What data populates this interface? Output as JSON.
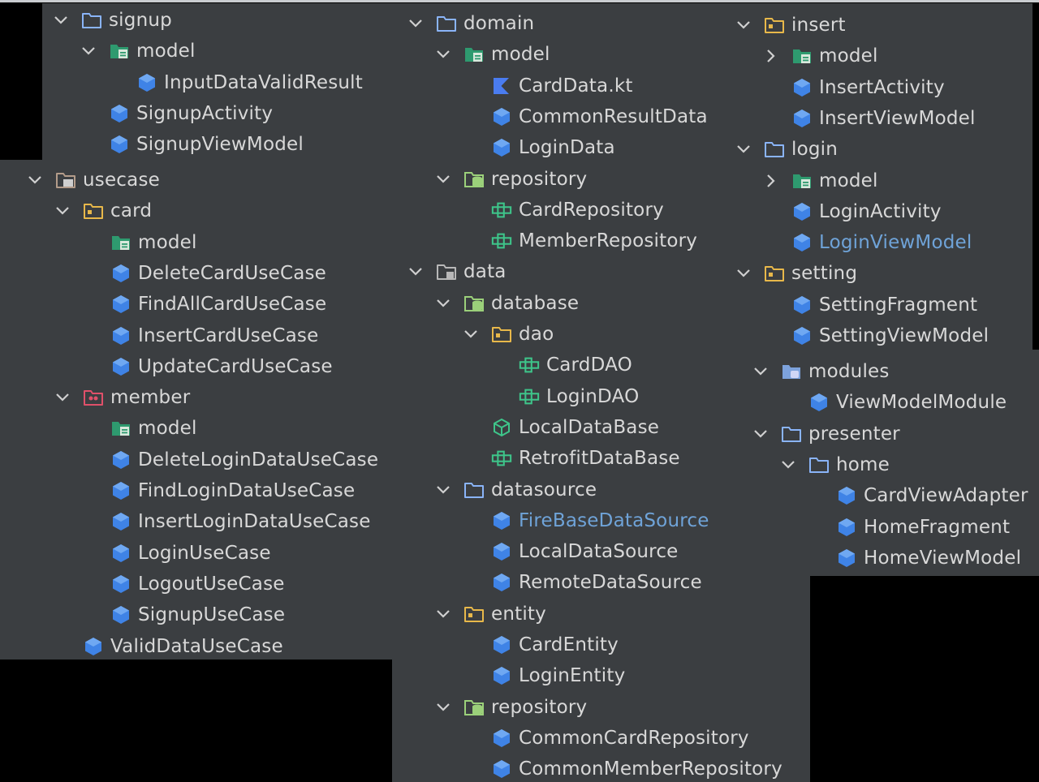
{
  "tree": {
    "left_top": [
      {
        "name": "signup",
        "icon": "folder",
        "chevron": "down",
        "indent": 0
      },
      {
        "name": "model",
        "icon": "package-folder",
        "chevron": "down",
        "indent": 1
      },
      {
        "name": "InputDataValidResult",
        "icon": "class",
        "indent": 2
      },
      {
        "name": "SignupActivity",
        "icon": "class",
        "indent": 1
      },
      {
        "name": "SignupViewModel",
        "icon": "class",
        "indent": 1
      }
    ],
    "left_bottom": [
      {
        "name": "usecase",
        "icon": "module-folder",
        "chevron": "down",
        "indent": 0
      },
      {
        "name": "card",
        "icon": "source-folder",
        "chevron": "down",
        "indent": 1
      },
      {
        "name": "model",
        "icon": "package-folder",
        "indent": 2
      },
      {
        "name": "DeleteCardUseCase",
        "icon": "class",
        "indent": 2
      },
      {
        "name": "FindAllCardUseCase",
        "icon": "class",
        "indent": 2
      },
      {
        "name": "InsertCardUseCase",
        "icon": "class",
        "indent": 2
      },
      {
        "name": "UpdateCardUseCase",
        "icon": "class",
        "indent": 2
      },
      {
        "name": "member",
        "icon": "members-folder",
        "chevron": "down",
        "indent": 1
      },
      {
        "name": "model",
        "icon": "package-folder",
        "indent": 2
      },
      {
        "name": "DeleteLoginDataUseCase",
        "icon": "class",
        "indent": 2
      },
      {
        "name": "FindLoginDataUseCase",
        "icon": "class",
        "indent": 2
      },
      {
        "name": "InsertLoginDataUseCase",
        "icon": "class",
        "indent": 2
      },
      {
        "name": "LoginUseCase",
        "icon": "class",
        "indent": 2
      },
      {
        "name": "LogoutUseCase",
        "icon": "class",
        "indent": 2
      },
      {
        "name": "SignupUseCase",
        "icon": "class",
        "indent": 2
      },
      {
        "name": "ValidDataUseCase",
        "icon": "class",
        "indent": 1
      }
    ],
    "middle": [
      {
        "name": "domain",
        "icon": "folder",
        "chevron": "down",
        "indent": 0
      },
      {
        "name": "model",
        "icon": "package-folder",
        "chevron": "down",
        "indent": 1
      },
      {
        "name": "CardData.kt",
        "icon": "kotlin-file",
        "indent": 2
      },
      {
        "name": "CommonResultData",
        "icon": "class",
        "indent": 2
      },
      {
        "name": "LoginData",
        "icon": "class",
        "indent": 2
      },
      {
        "name": "repository",
        "icon": "db-folder",
        "chevron": "down",
        "indent": 1
      },
      {
        "name": "CardRepository",
        "icon": "interface",
        "indent": 2
      },
      {
        "name": "MemberRepository",
        "icon": "interface",
        "indent": 2
      },
      {
        "name": "data",
        "icon": "locked-folder",
        "chevron": "down",
        "indent": 0
      },
      {
        "name": "database",
        "icon": "db-folder",
        "chevron": "down",
        "indent": 1
      },
      {
        "name": "dao",
        "icon": "source-folder",
        "chevron": "down",
        "indent": 2
      },
      {
        "name": "CardDAO",
        "icon": "interface",
        "indent": 3
      },
      {
        "name": "LoginDAO",
        "icon": "interface",
        "indent": 3
      },
      {
        "name": "LocalDataBase",
        "icon": "abstract-class",
        "indent": 2
      },
      {
        "name": "RetrofitDataBase",
        "icon": "interface",
        "indent": 2
      },
      {
        "name": "datasource",
        "icon": "folder",
        "chevron": "down",
        "indent": 1
      },
      {
        "name": "FireBaseDataSource",
        "icon": "class",
        "indent": 2,
        "highlight": true
      },
      {
        "name": "LocalDataSource",
        "icon": "class",
        "indent": 2
      },
      {
        "name": "RemoteDataSource",
        "icon": "class",
        "indent": 2
      },
      {
        "name": "entity",
        "icon": "source-folder",
        "chevron": "down",
        "indent": 1
      },
      {
        "name": "CardEntity",
        "icon": "class",
        "indent": 2
      },
      {
        "name": "LoginEntity",
        "icon": "class",
        "indent": 2
      },
      {
        "name": "repository",
        "icon": "db-folder",
        "chevron": "down",
        "indent": 1
      },
      {
        "name": "CommonCardRepository",
        "icon": "class",
        "indent": 2
      },
      {
        "name": "CommonMemberRepository",
        "icon": "class",
        "indent": 2
      }
    ],
    "right_top": [
      {
        "name": "insert",
        "icon": "source-folder",
        "chevron": "down",
        "indent": 0
      },
      {
        "name": "model",
        "icon": "package-folder",
        "chevron": "right",
        "indent": 1
      },
      {
        "name": "InsertActivity",
        "icon": "class",
        "indent": 1
      },
      {
        "name": "InsertViewModel",
        "icon": "class",
        "indent": 1
      },
      {
        "name": "login",
        "icon": "folder",
        "chevron": "down",
        "indent": 0
      },
      {
        "name": "model",
        "icon": "package-folder",
        "chevron": "right",
        "indent": 1
      },
      {
        "name": "LoginActivity",
        "icon": "class",
        "indent": 1
      },
      {
        "name": "LoginViewModel",
        "icon": "class",
        "indent": 1,
        "highlight": true
      },
      {
        "name": "setting",
        "icon": "source-folder",
        "chevron": "down",
        "indent": 0
      },
      {
        "name": "SettingFragment",
        "icon": "class",
        "indent": 1
      },
      {
        "name": "SettingViewModel",
        "icon": "class",
        "indent": 1
      }
    ],
    "right_bottom": [
      {
        "name": "modules",
        "icon": "module-blue-folder",
        "chevron": "down",
        "indent": 0
      },
      {
        "name": "ViewModelModule",
        "icon": "class",
        "indent": 1
      },
      {
        "name": "presenter",
        "icon": "folder",
        "chevron": "down",
        "indent": 0
      },
      {
        "name": "home",
        "icon": "folder",
        "chevron": "down",
        "indent": 1
      },
      {
        "name": "CardViewAdapter",
        "icon": "class",
        "indent": 2
      },
      {
        "name": "HomeFragment",
        "icon": "class",
        "indent": 2
      },
      {
        "name": "HomeViewModel",
        "icon": "class",
        "indent": 2
      }
    ]
  },
  "colors": {
    "panel_bg": "#3b3e41",
    "text": "#d8d8d8",
    "highlight_text": "#6fa3d8",
    "class_blue": "#3f83e6",
    "interface_green": "#3ec58a",
    "folder_blue": "#8ab4f8",
    "folder_yellow": "#e8b84a",
    "package_green": "#2e9a6f",
    "members_red": "#e0506a",
    "kotlin_blue": "#4a7cf0"
  }
}
